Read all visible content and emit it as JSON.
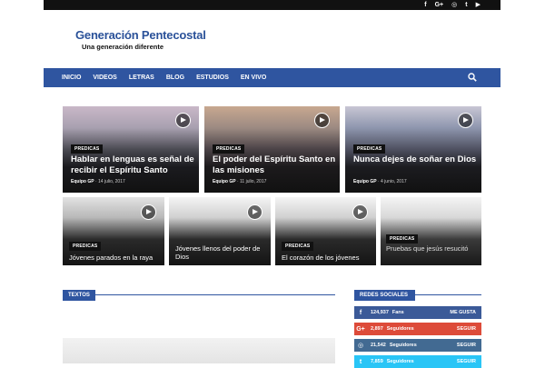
{
  "social_top": [
    "f",
    "G+",
    "◎",
    "t",
    "▶"
  ],
  "logo": {
    "title": "Generación Pentecostal",
    "subtitle": "Una generación diferente"
  },
  "nav": {
    "items": [
      "INICIO",
      "VIDEOS",
      "LETRAS",
      "BLOG",
      "ESTUDIOS",
      "EN VIVO"
    ]
  },
  "featured": [
    {
      "category": "PREDICAS",
      "title": "Hablar en lenguas es señal de recibir el Espíritu Santo",
      "author": "Equipo GP",
      "date": "14 julio, 2017"
    },
    {
      "category": "PREDICAS",
      "title": "El poder del Espíritu Santo en las misiones",
      "author": "Equipo GP",
      "date": "11 julio, 2017"
    },
    {
      "category": "PREDICAS",
      "title": "Nunca dejes de soñar en Dios",
      "author": "Equipo GP",
      "date": "4 junio, 2017"
    }
  ],
  "small": [
    {
      "category": "PREDICAS",
      "title": "Jóvenes parados en la raya"
    },
    {
      "category": "",
      "title": "Jóvenes llenos del poder de Dios"
    },
    {
      "category": "PREDICAS",
      "title": "El corazón de los jóvenes"
    },
    {
      "category": "PREDICAS",
      "title": "Pruebas que jesús resucitó"
    }
  ],
  "sections": {
    "textos": "TEXTOS",
    "redes": "REDES SOCIALES"
  },
  "social_counters": [
    {
      "icon": "f",
      "count": "124,937",
      "unit": "Fans",
      "action": "ME GUSTA",
      "color": "#3b5a98"
    },
    {
      "icon": "G+",
      "count": "2,897",
      "unit": "Seguidores",
      "action": "SEGUIR",
      "color": "#dd4b39"
    },
    {
      "icon": "◎",
      "count": "21,542",
      "unit": "Seguidores",
      "action": "SEGUIR",
      "color": "#426a92"
    },
    {
      "icon": "t",
      "count": "7,859",
      "unit": "Seguidores",
      "action": "SEGUIR",
      "color": "#29c5f6"
    }
  ]
}
